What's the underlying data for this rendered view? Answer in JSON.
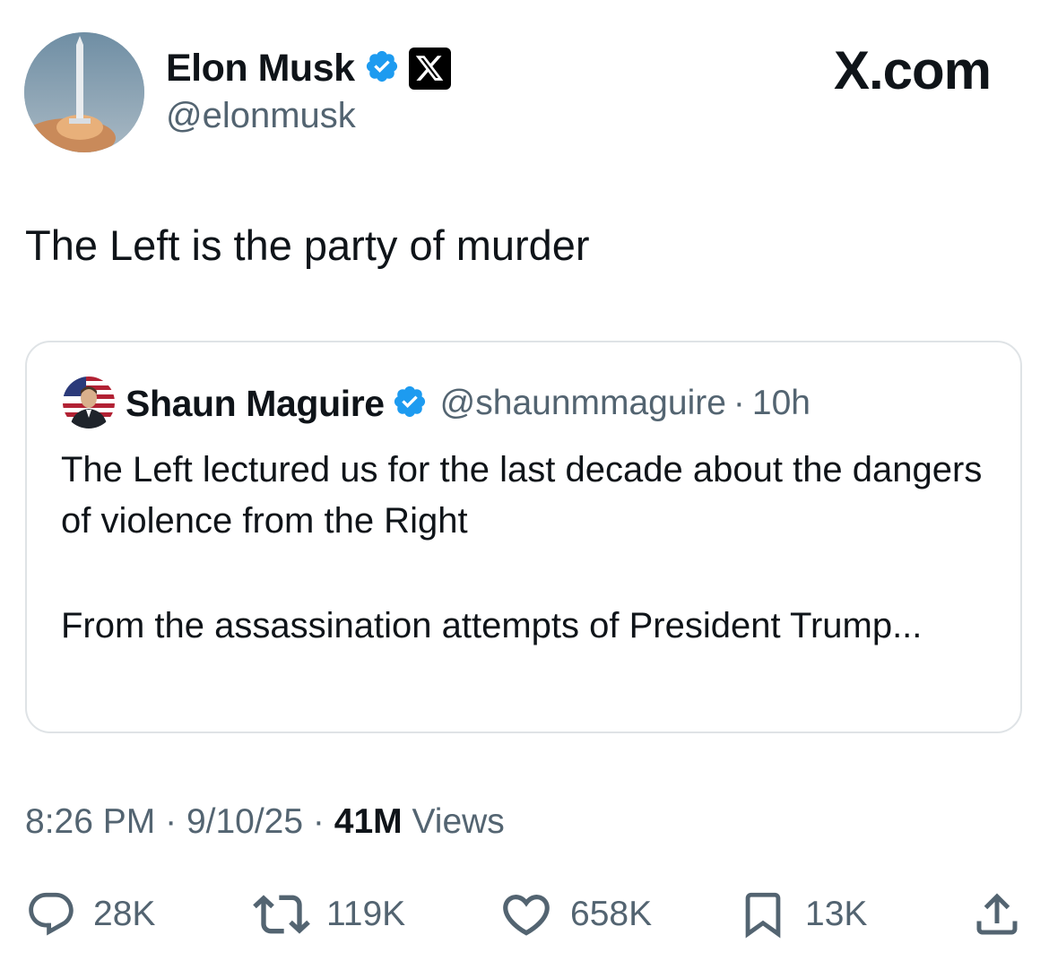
{
  "post": {
    "author": {
      "name": "Elon Musk",
      "handle": "@elonmusk"
    },
    "site_label": "X.com",
    "text": "The Left is the party of murder",
    "quoted": {
      "author_name": "Shaun Maguire",
      "handle": "@shaunmmaguire",
      "separator": "·",
      "age": "10h",
      "paragraph1": "The Left lectured us for the last decade about the dangers of violence from the Right",
      "paragraph2": "From the assassination attempts of President Trump..."
    },
    "meta": {
      "time": "8:26 PM",
      "sep1": "·",
      "date": "9/10/25",
      "sep2": "·",
      "views_count": "41M",
      "views_label": "Views"
    },
    "actions": {
      "replies": "28K",
      "reposts": "119K",
      "likes": "658K",
      "bookmarks": "13K"
    }
  },
  "icons": {
    "verified": "verified-badge-icon",
    "affiliate": "x-logo-icon",
    "reply": "reply-icon",
    "repost": "repost-icon",
    "like": "heart-icon",
    "bookmark": "bookmark-icon",
    "share": "share-icon"
  },
  "colors": {
    "verified_blue": "#1d9bf0",
    "text_primary": "#0f1419",
    "text_secondary": "#536471",
    "border": "#dfe3e6"
  }
}
